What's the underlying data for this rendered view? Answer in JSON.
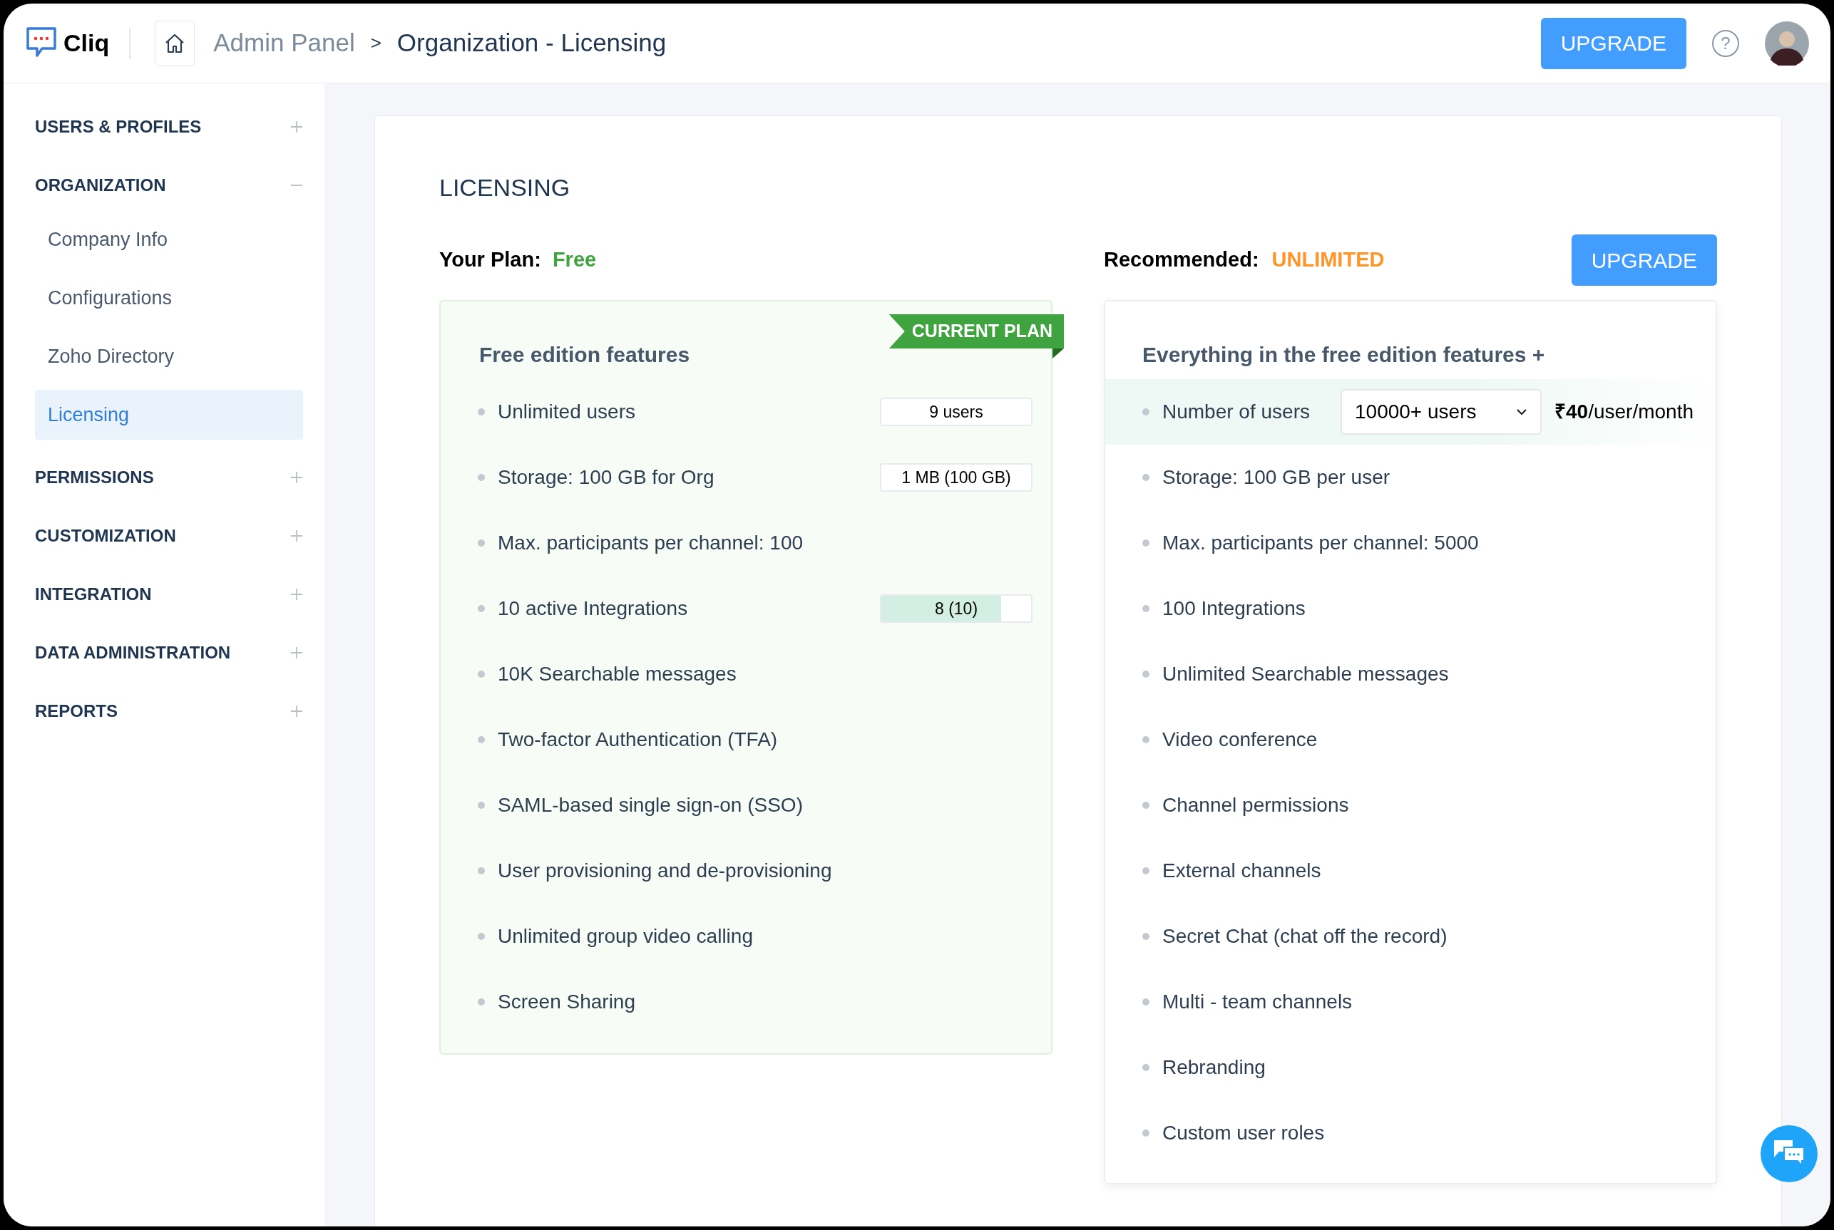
{
  "header": {
    "app_name": "Cliq",
    "breadcrumb": [
      "Admin Panel",
      "Organization - Licensing"
    ],
    "breadcrumb_separator": ">",
    "upgrade_button": "UPGRADE",
    "help_icon": "?"
  },
  "sidebar": {
    "sections": [
      {
        "label": "USERS & PROFILES",
        "expanded": false
      },
      {
        "label": "ORGANIZATION",
        "expanded": true,
        "children": [
          {
            "label": "Company Info",
            "selected": false
          },
          {
            "label": "Configurations",
            "selected": false
          },
          {
            "label": "Zoho Directory",
            "selected": false
          },
          {
            "label": "Licensing",
            "selected": true
          }
        ]
      },
      {
        "label": "PERMISSIONS",
        "expanded": false
      },
      {
        "label": "CUSTOMIZATION",
        "expanded": false
      },
      {
        "label": "INTEGRATION",
        "expanded": false
      },
      {
        "label": "DATA ADMINISTRATION",
        "expanded": false
      },
      {
        "label": "REPORTS",
        "expanded": false
      }
    ]
  },
  "licensing": {
    "title": "LICENSING",
    "your_plan": {
      "label": "Your Plan:",
      "value": "Free"
    },
    "recommended": {
      "label": "Recommended:",
      "value": "UNLIMITED"
    },
    "upgrade_button": "UPGRADE",
    "current_plan": {
      "title": "Free edition features",
      "badge": "CURRENT PLAN",
      "features": [
        {
          "text": "Unlimited users",
          "usage": {
            "text": "9 users"
          }
        },
        {
          "text": "Storage: 100 GB for Org",
          "usage": {
            "text": "1 MB (100 GB)"
          }
        },
        {
          "text": "Max. participants per channel: 100"
        },
        {
          "text": "10 active Integrations",
          "usage": {
            "text": "8 (10)",
            "level": 0.8
          }
        },
        {
          "text": "10K Searchable messages"
        },
        {
          "text": "Two-factor Authentication (TFA)"
        },
        {
          "text": "SAML-based single sign-on (SSO)"
        },
        {
          "text": "User provisioning and de-provisioning"
        },
        {
          "text": "Unlimited group video calling"
        },
        {
          "text": "Screen Sharing"
        }
      ]
    },
    "recommended_plan": {
      "title": "Everything in the free edition features +",
      "features": [
        {
          "text": "Number of users",
          "kind": "picker",
          "dropdown": "10000+ users",
          "price": "**₹40**/user/month"
        },
        {
          "text": "Storage: 100 GB per user",
          "kind": "plain"
        },
        {
          "text": "Max. participants per channel: 5000",
          "kind": "plain"
        },
        {
          "text": "100 Integrations",
          "kind": "plain"
        },
        {
          "text": "Unlimited Searchable messages",
          "kind": "plain"
        },
        {
          "text": "Video conference",
          "kind": "plain"
        },
        {
          "text": "Channel permissions",
          "kind": "plain"
        },
        {
          "text": "External channels",
          "kind": "plain"
        },
        {
          "text": "Secret Chat (chat off the record)",
          "kind": "plain"
        },
        {
          "text": "Multi - team channels",
          "kind": "plain"
        },
        {
          "text": "Rebranding",
          "kind": "plain"
        },
        {
          "text": "Custom user roles",
          "kind": "plain"
        }
      ]
    }
  }
}
